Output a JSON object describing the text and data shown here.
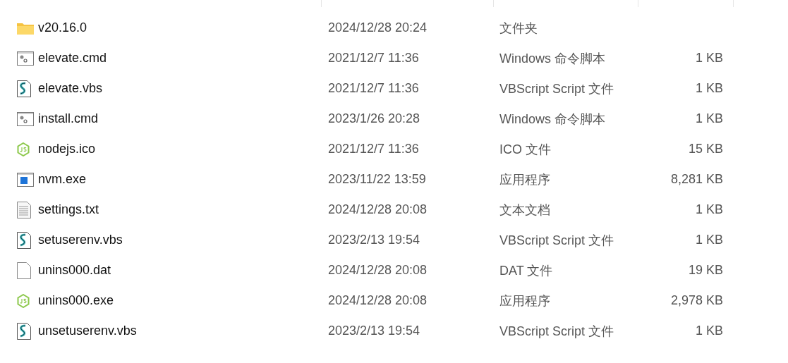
{
  "files": [
    {
      "name": "v20.16.0",
      "kind": "folder",
      "modified": "2024/12/28 20:24",
      "type": "文件夹"
    },
    {
      "name": "elevate.cmd",
      "kind": "cmd",
      "modified": "2021/12/7 11:36",
      "type": "Windows 命令脚本",
      "size": "1 KB"
    },
    {
      "name": "elevate.vbs",
      "kind": "script",
      "modified": "2021/12/7 11:36",
      "type": "VBScript Script 文件",
      "size": "1 KB"
    },
    {
      "name": "install.cmd",
      "kind": "cmd",
      "modified": "2023/1/26 20:28",
      "type": "Windows 命令脚本",
      "size": "1 KB"
    },
    {
      "name": "nodejs.ico",
      "kind": "node",
      "modified": "2021/12/7 11:36",
      "type": "ICO 文件",
      "size": "15 KB"
    },
    {
      "name": "nvm.exe",
      "kind": "exe",
      "modified": "2023/11/22 13:59",
      "type": "应用程序",
      "size": "8,281 KB"
    },
    {
      "name": "settings.txt",
      "kind": "text",
      "modified": "2024/12/28 20:08",
      "type": "文本文档",
      "size": "1 KB"
    },
    {
      "name": "setuserenv.vbs",
      "kind": "script",
      "modified": "2023/2/13 19:54",
      "type": "VBScript Script 文件",
      "size": "1 KB"
    },
    {
      "name": "unins000.dat",
      "kind": "blank",
      "modified": "2024/12/28 20:08",
      "type": "DAT 文件",
      "size": "19 KB"
    },
    {
      "name": "unins000.exe",
      "kind": "node",
      "modified": "2024/12/28 20:08",
      "type": "应用程序",
      "size": "2,978 KB"
    },
    {
      "name": "unsetuserenv.vbs",
      "kind": "script",
      "modified": "2023/2/13 19:54",
      "type": "VBScript Script 文件",
      "size": "1 KB"
    }
  ]
}
